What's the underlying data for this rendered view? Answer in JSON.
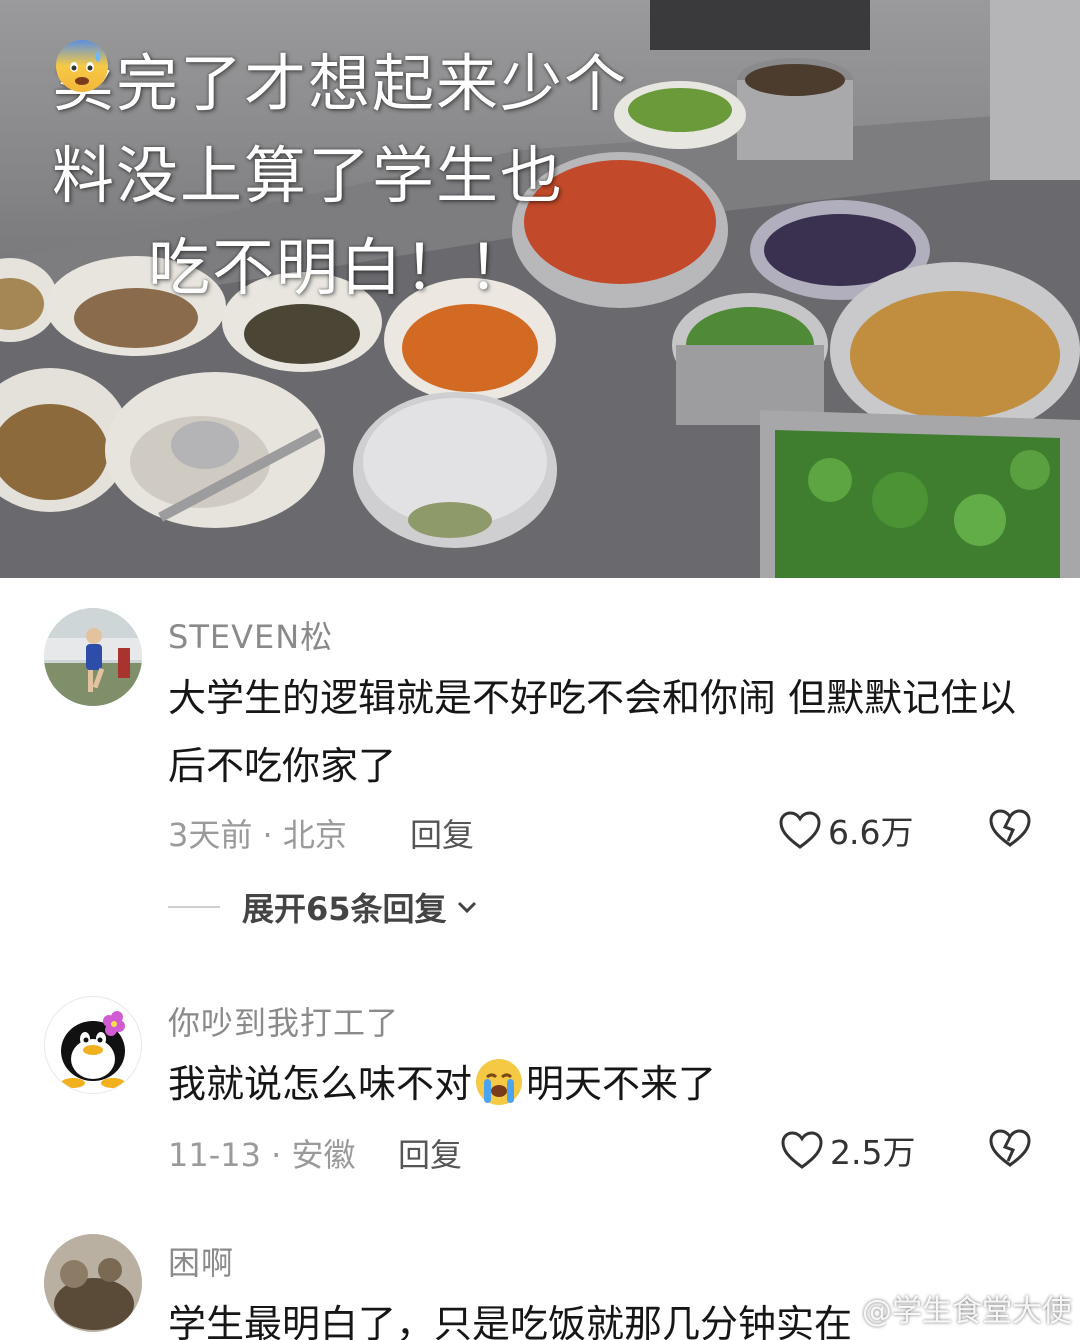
{
  "video": {
    "caption_line1": "卖完了才想起来少个",
    "caption_line2a": "料没上",
    "caption_emoji": "anxious-face-emoji",
    "caption_line2b": "算了学生也",
    "caption_line3": "吃不明白！！"
  },
  "comments": [
    {
      "username": "STEVEN松",
      "avatar": "runner-photo-avatar",
      "text": "大学生的逻辑就是不好吃不会和你闹 但默默记住以后不吃你家了",
      "meta": "3天前 · 北京",
      "reply_label": "回复",
      "likes": "6.6万",
      "expand_label": "展开65条回复"
    },
    {
      "username": "你吵到我打工了",
      "avatar": "penguin-avatar",
      "text_a": "我就说怎么味不对",
      "emoji": "crying-face-emoji",
      "text_b": "明天不来了",
      "meta": "11-13 · 安徽",
      "reply_label": "回复",
      "likes": "2.5万"
    },
    {
      "username": "困啊",
      "avatar": "photo-avatar",
      "text": "学生最明白了，只是吃饭就那几分钟实在"
    }
  ],
  "watermark": "@学生食堂大使",
  "colors": {
    "like_icon": "#333333",
    "username": "#8a8a8a",
    "meta": "#9a9a9a"
  }
}
